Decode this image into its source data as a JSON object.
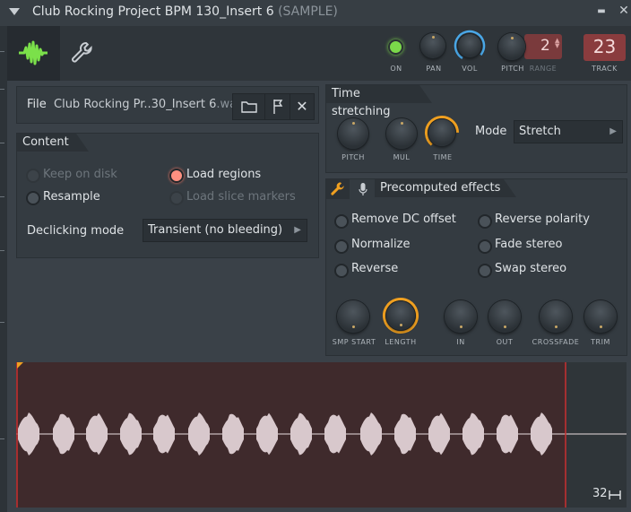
{
  "window": {
    "title_main": "Club Rocking Project BPM 130_Insert 6",
    "title_suffix": "(SAMPLE)",
    "minimize_glyph": "▬",
    "close_glyph": "✕"
  },
  "header": {
    "tabs": [
      "waveform-icon",
      "wrench-icon"
    ],
    "on_label": "ON",
    "pan_label": "PAN",
    "vol_label": "VOL",
    "pitch_label": "PITCH",
    "range_label": "RANGE",
    "range_value": "2",
    "track_label": "TRACK",
    "track_value": "23"
  },
  "file": {
    "label": "File",
    "name": "Club Rocking Pr..30_Insert 6",
    "ext": ".wav",
    "close_glyph": "✕"
  },
  "content": {
    "title": "Content",
    "options": [
      {
        "label": "Keep on disk",
        "state": "disabled"
      },
      {
        "label": "Load regions",
        "state": "on"
      },
      {
        "label": "Resample",
        "state": "off"
      },
      {
        "label": "Load slice markers",
        "state": "disabled"
      }
    ],
    "declicking_label": "Declicking mode",
    "declicking_value": "Transient (no bleeding)"
  },
  "time_stretching": {
    "title": "Time stretching",
    "knobs": [
      "PITCH",
      "MUL",
      "TIME"
    ],
    "mode_label": "Mode",
    "mode_value": "Stretch"
  },
  "precomputed": {
    "title": "Precomputed effects",
    "options": [
      {
        "label": "Remove DC offset"
      },
      {
        "label": "Reverse polarity"
      },
      {
        "label": "Normalize"
      },
      {
        "label": "Fade stereo"
      },
      {
        "label": "Reverse"
      },
      {
        "label": "Swap stereo"
      }
    ],
    "knobs": [
      "SMP START",
      "LENGTH",
      "IN",
      "OUT",
      "CROSSFADE",
      "TRIM"
    ]
  },
  "waveform": {
    "zoom_value": "32"
  },
  "colors": {
    "accent_orange": "#f0a020",
    "accent_blue": "#4aa8e8",
    "led_green": "#7bd84a",
    "radio_on": "#ff9080",
    "wave_fill": "#d8c8cc",
    "end_marker": "#c83030"
  }
}
